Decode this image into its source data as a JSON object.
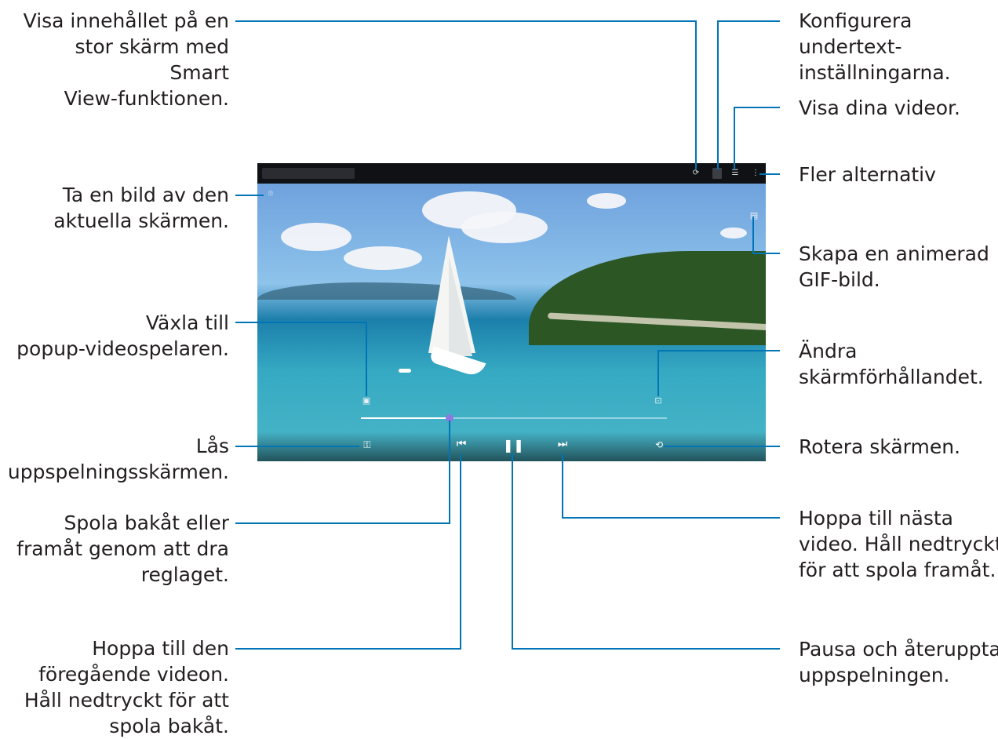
{
  "callouts": {
    "smart_view": "Visa innehållet på en\nstor skärm med\nSmart\nView-funktionen.",
    "capture": "Ta en bild av den\naktuella skärmen.",
    "popup": "Växla till\npopup-videospelaren.",
    "lock": "Lås\nuppspelningsskärmen.",
    "seek": "Spola bakåt eller\nframåt genom att dra\nreglaget.",
    "previous": "Hoppa till den\nföregående videon.\nHåll nedtryckt för att\nspola bakåt.",
    "subtitles": "Konfigurera\nundertext-\ninställningarna.",
    "list": "Visa dina videor.",
    "more": "Fler alternativ",
    "gif": "Skapa en animerad\nGIF-bild.",
    "ratio": "Ändra\nskärmförhållandet.",
    "rotate": "Rotera skärmen.",
    "next": "Hoppa till nästa\nvideo. Håll nedtryckt\nför att spola framåt.",
    "pause": "Pausa och återuppta\nuppspelningen."
  },
  "player": {
    "icons": {
      "smart_view": "smart-view-icon",
      "subtitles": "subtitles-icon",
      "list": "video-list-icon",
      "more": "more-options-icon",
      "capture": "capture-icon",
      "gif": "gif-icon",
      "popup": "popup-player-icon",
      "ratio": "screen-ratio-icon",
      "lock": "lock-icon",
      "previous": "previous-icon",
      "pause": "pause-icon",
      "next": "next-icon",
      "rotate": "rotate-icon"
    },
    "glyphs": {
      "smart_view": "⟳",
      "list": "☰",
      "more": "⋮",
      "capture": "⌾",
      "gif": "▤",
      "popup": "▣",
      "ratio": "⊡",
      "lock": "⚿",
      "previous": "⏮",
      "pause": "❚❚",
      "next": "⏭",
      "rotate": "⟲"
    },
    "progress": 0.29
  },
  "colors": {
    "callout_line": "#0074b4",
    "seek_knob": "#8a7be0"
  }
}
